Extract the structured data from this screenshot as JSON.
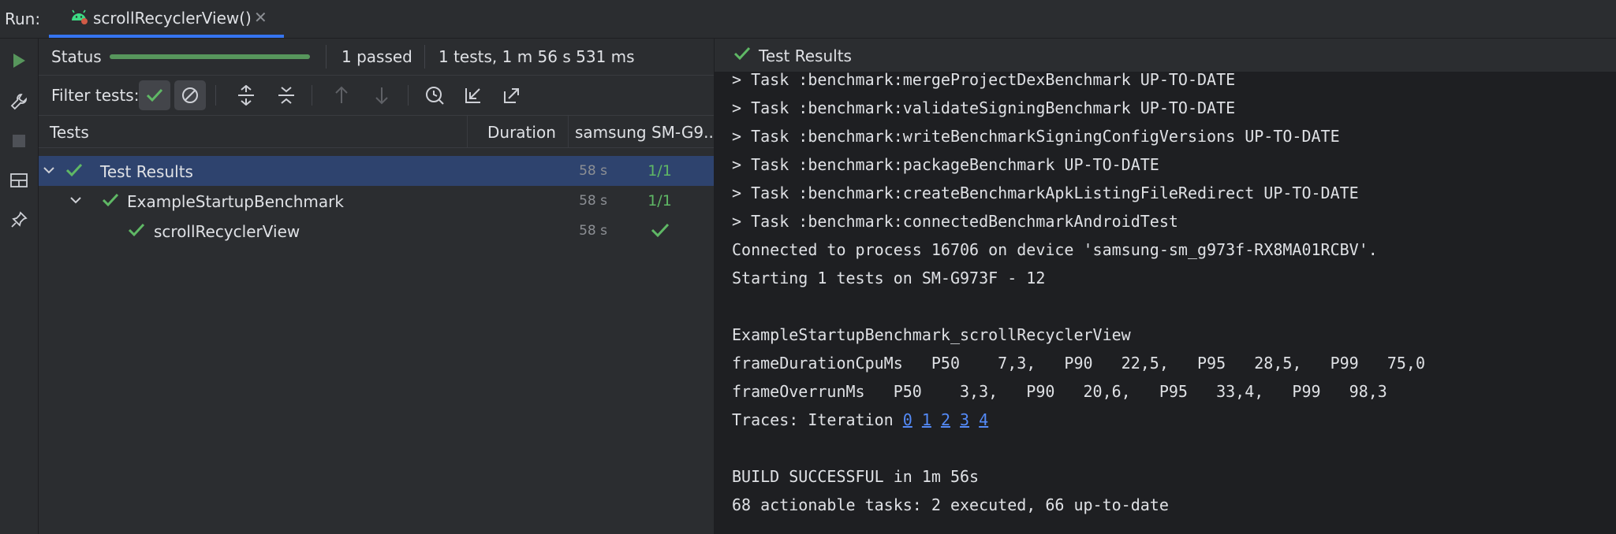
{
  "topbar": {
    "run_label": "Run:",
    "tab_title": "scrollRecyclerView()",
    "tab_icon": "android-icon",
    "close_glyph": "✕"
  },
  "toolbar": {
    "status_label": "Status",
    "progress_fraction": 1.0,
    "passed_text": "1 passed",
    "summary_text": "1 tests, 1 m 56 s 531 ms",
    "filter_label": "Filter tests:"
  },
  "table": {
    "col_tests": "Tests",
    "col_duration": "Duration",
    "col_device": "samsung SM-G9...",
    "rows": [
      {
        "name": "Test Results",
        "duration": "58 s",
        "result": "1/1"
      },
      {
        "name": "ExampleStartupBenchmark",
        "duration": "58 s",
        "result": "1/1"
      },
      {
        "name": "scrollRecyclerView",
        "duration": "58 s",
        "result": ""
      }
    ]
  },
  "results_header": "Test Results",
  "console": {
    "lines": [
      "> Task :benchmark:validateSigningBenchmark UP-TO-DATE",
      "> Task :benchmark:writeBenchmarkSigningConfigVersions UP-TO-DATE",
      "> Task :benchmark:packageBenchmark UP-TO-DATE",
      "> Task :benchmark:createBenchmarkApkListingFileRedirect UP-TO-DATE",
      "> Task :benchmark:connectedBenchmarkAndroidTest",
      "Connected to process 16706 on device 'samsung-sm_g973f-RX8MA01RCBV'.",
      "Starting 1 tests on SM-G973F - 12",
      "",
      "ExampleStartupBenchmark_scrollRecyclerView",
      "frameDurationCpuMs   P50    7,3,   P90   22,5,   P95   28,5,   P99   75,0",
      "frameOverrunMs   P50    3,3,   P90   20,6,   P95   33,4,   P99   98,3"
    ],
    "traces_prefix": "Traces: Iteration ",
    "trace_links": [
      "0",
      "1",
      "2",
      "3",
      "4"
    ],
    "build_result": "BUILD SUCCESSFUL in 1m 56s",
    "tasks_summary": "68 actionable tasks: 2 executed, 66 up-to-date"
  },
  "colors": {
    "success": "#5fb865",
    "progress": "#57965c",
    "selection": "#2e436e",
    "link": "#548af7",
    "accent": "#3574f0"
  }
}
